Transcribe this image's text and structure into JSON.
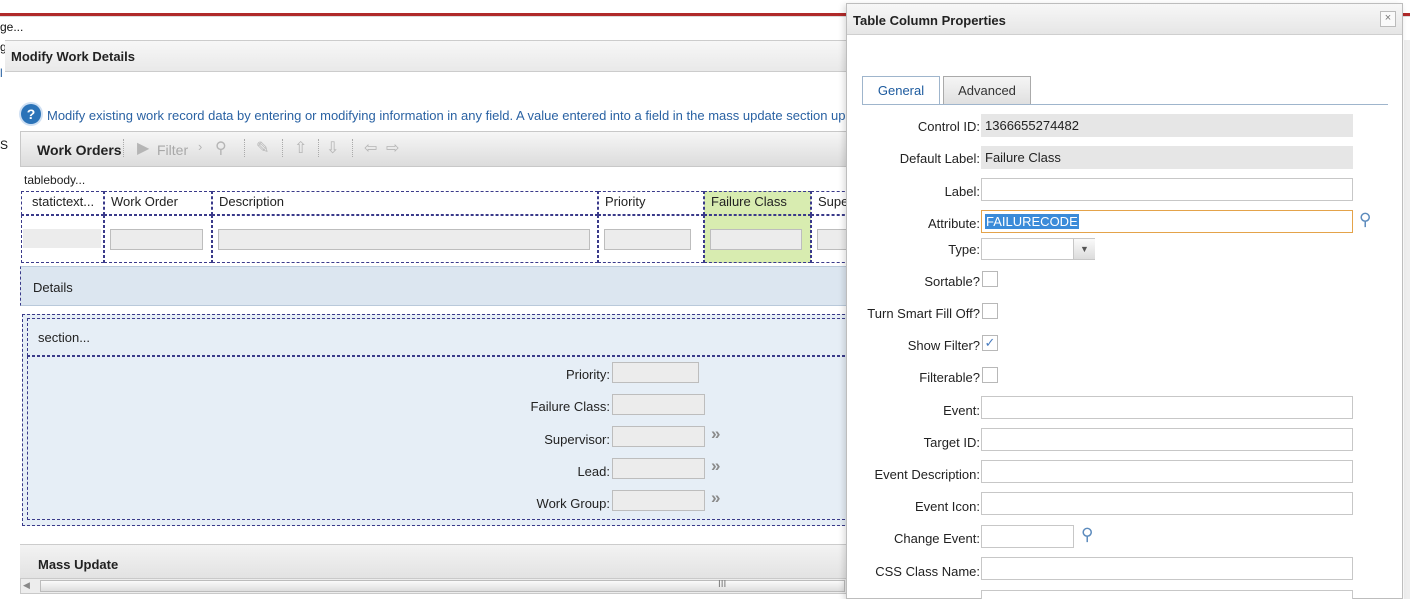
{
  "background": {
    "top_text_1": "ge...",
    "top_text_2": "g",
    "side_letter_l": "l",
    "side_letter_s": "S",
    "dialog_title": "Modify Work Details",
    "help_text": "Modify existing work record data by entering or modifying information in any field. A value entered into a field in the mass update section up",
    "toolbar": {
      "title": "Work Orders",
      "filter_label": "Filter"
    },
    "tablebody_label": "tablebody...",
    "columns": [
      "statictext...",
      "Work Order",
      "Description",
      "Priority",
      "Failure Class",
      "Supe"
    ],
    "details_label": "Details",
    "section_label": "section...",
    "section_fields": [
      {
        "label": "Priority:",
        "has_lookup": false
      },
      {
        "label": "Failure Class:",
        "has_lookup": false
      },
      {
        "label": "Supervisor:",
        "has_lookup": true
      },
      {
        "label": "Lead:",
        "has_lookup": true
      },
      {
        "label": "Work Group:",
        "has_lookup": true
      }
    ],
    "mass_update_label": "Mass Update",
    "scroll_grip": "III"
  },
  "panel": {
    "title": "Table Column Properties",
    "close_glyph": "×",
    "tabs": [
      {
        "label": "General",
        "active": true
      },
      {
        "label": "Advanced",
        "active": false
      }
    ],
    "fields": [
      {
        "label": "Control ID:",
        "value": "1366655274482",
        "kind": "readonly"
      },
      {
        "label": "Default Label:",
        "value": "Failure Class",
        "kind": "readonly"
      },
      {
        "label": "Label:",
        "value": "",
        "kind": "text"
      },
      {
        "label": "Attribute:",
        "value": "FAILURECODE",
        "kind": "focused"
      },
      {
        "label": "Type:",
        "value": "",
        "kind": "select"
      },
      {
        "label": "Sortable?",
        "checked": false,
        "kind": "checkbox"
      },
      {
        "label": "Turn Smart Fill Off?",
        "checked": false,
        "kind": "checkbox"
      },
      {
        "label": "Show Filter?",
        "checked": true,
        "kind": "checkbox"
      },
      {
        "label": "Filterable?",
        "checked": false,
        "kind": "checkbox"
      },
      {
        "label": "Event:",
        "value": "",
        "kind": "text"
      },
      {
        "label": "Target ID:",
        "value": "",
        "kind": "text"
      },
      {
        "label": "Event Description:",
        "value": "",
        "kind": "text"
      },
      {
        "label": "Event Icon:",
        "value": "",
        "kind": "text"
      },
      {
        "label": "Change Event:",
        "value": "",
        "kind": "short"
      },
      {
        "label": "CSS Class Name:",
        "value": "",
        "kind": "text"
      }
    ],
    "check_glyph": "✓"
  },
  "colors": {
    "accent_red": "#b02a2a",
    "link_blue": "#2a62a3",
    "highlight_green": "#d8ecb0",
    "selection_blue": "#3b8bd9",
    "focus_orange": "#e4a34a"
  }
}
